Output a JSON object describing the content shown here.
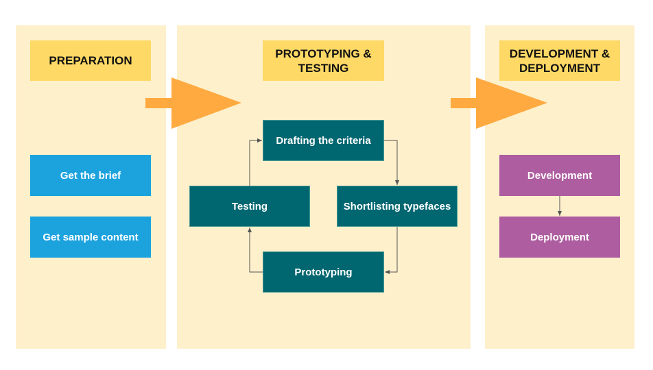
{
  "colors": {
    "panel_bg": "#fff0cc",
    "header_bg": "#ffd966",
    "arrow": "#ffaa40",
    "prep_task": "#1ca3de",
    "proto_task": "#006670",
    "dev_task": "#ae5ea0",
    "connector": "#555555"
  },
  "phases": [
    {
      "title": "PREPARATION",
      "tasks": [
        "Get the brief",
        "Get sample content"
      ]
    },
    {
      "title": "PROTOTYPING & TESTING",
      "tasks": [
        "Drafting the criteria",
        "Shortlisting typefaces",
        "Prototyping",
        "Testing"
      ]
    },
    {
      "title": "DEVELOPMENT & DEPLOYMENT",
      "tasks": [
        "Development",
        "Deployment"
      ]
    }
  ],
  "flow": {
    "phase_arrows": [
      "PREPARATION → PROTOTYPING & TESTING",
      "PROTOTYPING & TESTING → DEVELOPMENT & DEPLOYMENT"
    ],
    "cycle": [
      "Drafting the criteria",
      "Shortlisting typefaces",
      "Prototyping",
      "Testing",
      "Drafting the criteria"
    ],
    "dev_sequence": [
      "Development",
      "Deployment"
    ]
  }
}
